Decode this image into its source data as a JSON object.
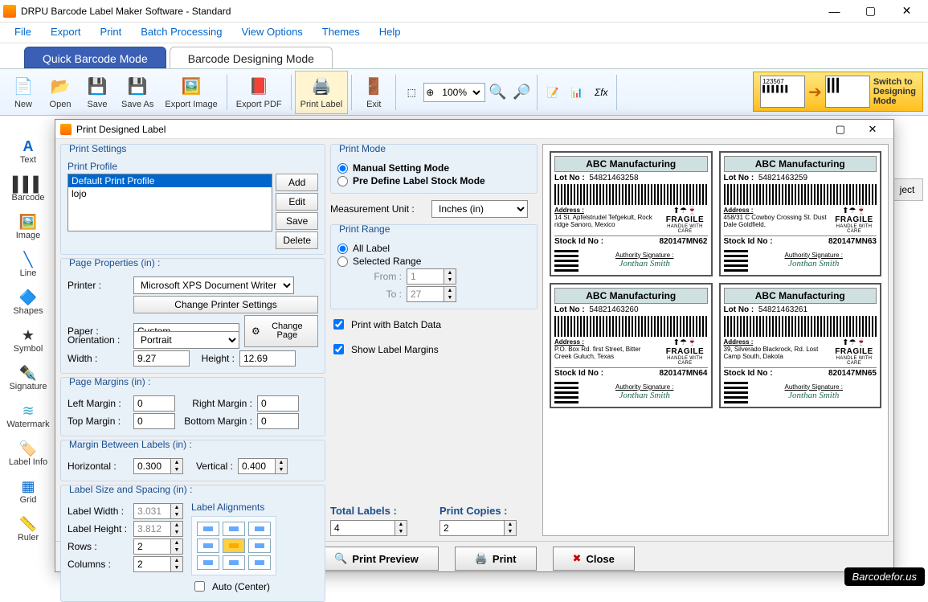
{
  "title": "DRPU Barcode Label Maker Software - Standard",
  "menu": [
    "File",
    "Export",
    "Print",
    "Batch Processing",
    "View Options",
    "Themes",
    "Help"
  ],
  "modes": {
    "quick": "Quick Barcode Mode",
    "design": "Barcode Designing Mode"
  },
  "toolbar": [
    "New",
    "Open",
    "Save",
    "Save As",
    "Export Image",
    "Export PDF",
    "Print Label",
    "Exit"
  ],
  "zoom": "100%",
  "switch": {
    "line1": "Switch to",
    "line2": "Designing",
    "line3": "Mode"
  },
  "side": [
    "Text",
    "Barcode",
    "Image",
    "Line",
    "Shapes",
    "Symbol",
    "Signature",
    "Watermark",
    "Label Info",
    "Grid",
    "Ruler"
  ],
  "rtab": "ject",
  "dialog": {
    "title": "Print Designed Label",
    "printSettings": "Print Settings",
    "printProfile": "Print Profile",
    "profiles": [
      "Default Print Profile",
      "lojo"
    ],
    "btns": {
      "add": "Add",
      "edit": "Edit",
      "save": "Save",
      "delete": "Delete"
    },
    "pageProps": "Page Properties (in) :",
    "printer": "Printer :",
    "printerVal": "Microsoft XPS Document Writer",
    "changePrinter": "Change Printer Settings",
    "paper": "Paper :",
    "paperVal": "Custom",
    "changePage": "Change Page",
    "orient": "Orientation :",
    "orientVal": "Portrait",
    "width": "Width :",
    "widthVal": "9.27",
    "height": "Height :",
    "heightVal": "12.69",
    "pageMargins": "Page Margins (in) :",
    "leftM": "Left Margin :",
    "leftMVal": "0",
    "rightM": "Right Margin :",
    "rightMVal": "0",
    "topM": "Top Margin :",
    "topMVal": "0",
    "botM": "Bottom Margin :",
    "botMVal": "0",
    "marginBetween": "Margin Between Labels (in) :",
    "horiz": "Horizontal :",
    "horizVal": "0.300",
    "vert": "Vertical :",
    "vertVal": "0.400",
    "labelSize": "Label Size and Spacing (in) :",
    "labelW": "Label Width :",
    "labelWVal": "3.031",
    "labelH": "Label Height :",
    "labelHVal": "3.812",
    "rows": "Rows :",
    "rowsVal": "2",
    "cols": "Columns :",
    "colsVal": "2",
    "labelAlign": "Label Alignments",
    "autoCenter": "Auto (Center)",
    "printMode": "Print Mode",
    "manual": "Manual Setting Mode",
    "predefine": "Pre Define Label Stock Mode",
    "measUnit": "Measurement Unit :",
    "measUnitVal": "Inches (in)",
    "printRange": "Print Range",
    "allLabel": "All Label",
    "selRange": "Selected Range",
    "from": "From :",
    "fromVal": "1",
    "to": "To :",
    "toVal": "27",
    "batchData": "Print with Batch Data",
    "showMargins": "Show Label Margins",
    "totalLabels": "Total Labels :",
    "totalLabelsVal": "4",
    "printCopies": "Print Copies :",
    "printCopiesVal": "2",
    "preview": "Print Preview",
    "print": "Print",
    "close": "Close"
  },
  "labels": [
    {
      "hdr": "ABC Manufacturing",
      "lot": "54821463258",
      "addr": "14 St. Apfelstrudel Tefgekult, Rock ridge Sanoro, Mexico",
      "stock": "820147MN62"
    },
    {
      "hdr": "ABC Manufacturing",
      "lot": "54821463259",
      "addr": "458/31 C Cowboy Crossing St. Dust Dale Goldfield,",
      "stock": "820147MN63"
    },
    {
      "hdr": "ABC Manufacturing",
      "lot": "54821463260",
      "addr": "P.O. Box Rd. first Street, Bitter Creek Guluch, Texas",
      "stock": "820147MN64"
    },
    {
      "hdr": "ABC Manufacturing",
      "lot": "54821463261",
      "addr": "39, Silverado Blackrock, Rd. Lost Camp South, Dakota",
      "stock": "820147MN65"
    }
  ],
  "labelStatic": {
    "lotNo": "Lot No :",
    "address": "Address :",
    "fragile": "FRAGILE",
    "hwc": "HANDLE WITH CARE",
    "stockId": "Stock Id No :",
    "auth": "Authority Signature :",
    "sig": "Jonthan Smith"
  },
  "branding": "Barcodefor.us"
}
